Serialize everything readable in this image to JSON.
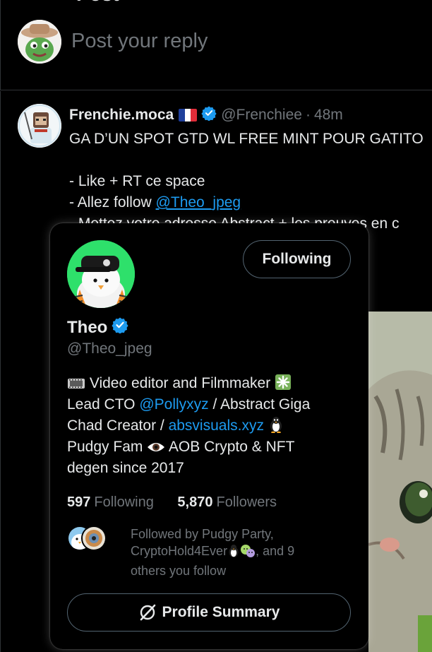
{
  "header": {
    "title": "Post"
  },
  "composer": {
    "placeholder": "Post your reply"
  },
  "tweet": {
    "author_name": "Frenchie.moca",
    "author_handle": "@Frenchiee",
    "separator": "·",
    "time": "48m",
    "lines": [
      "GA D’UN SPOT GTD WL FREE MINT POUR GATITO",
      "- Like + RT ce space",
      "- Allez follow ",
      "- Mettez votre adresse Abstract + les preuves en c"
    ],
    "mention": "@Theo_jpeg"
  },
  "hover_card": {
    "follow_button_label": "Following",
    "name": "Theo",
    "handle": "@Theo_jpeg",
    "bio": {
      "line1_text": " Video editor and Filmmaker ",
      "line2_a": "Lead CTO ",
      "line2_mention": "@Pollyxyz",
      "line2_b": " / Abstract Giga",
      "line3_a": "Chad Creator / ",
      "line3_link": "absvisuals.xyz",
      "line4_a": "Pudgy Fam ",
      "line4_b": " AOB Crypto & NFT",
      "line5": "degen since 2017"
    },
    "following_count": "597",
    "following_label": "Following",
    "followers_count": "5,870",
    "followers_label": "Followers",
    "followed_by_line1": "Followed by Pudgy Party,",
    "followed_by_line2a": "CryptoHold4Ever",
    "followed_by_line2b": ", and 9",
    "followed_by_line3": "others you follow",
    "profile_summary_label": "Profile Summary"
  },
  "colors": {
    "background": "#000000",
    "accent": "#1d9bf0",
    "text": "#e7e9ea",
    "muted": "#71767b",
    "border": "#2f3336"
  }
}
